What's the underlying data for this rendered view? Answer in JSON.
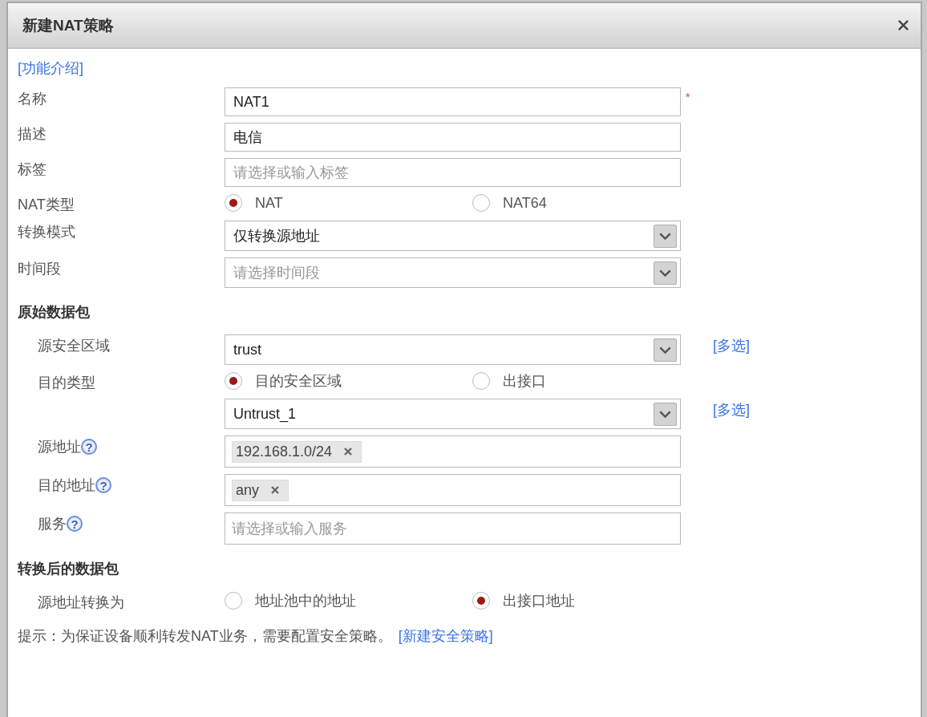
{
  "window": {
    "title": "新建NAT策略"
  },
  "intro_link": "[功能介绍]",
  "fields": [
    {
      "kind": "input",
      "label": "名称",
      "value": "NAT1",
      "required_mark": "*"
    },
    {
      "kind": "input",
      "label": "描述",
      "value": "电信"
    },
    {
      "kind": "input",
      "label": "标签",
      "placeholder": "请选择或输入标签"
    },
    {
      "kind": "radio",
      "label": "NAT类型",
      "options": [
        {
          "label": "NAT",
          "selected": true
        },
        {
          "label": "NAT64",
          "selected": false
        }
      ]
    },
    {
      "kind": "select",
      "label": "转换模式",
      "value": "仅转换源地址"
    },
    {
      "kind": "select",
      "label": "时间段",
      "placeholder": "请选择时间段"
    }
  ],
  "sections": [
    {
      "heading": "原始数据包",
      "fields": [
        {
          "kind": "select",
          "label": "源安全区域",
          "value": "trust",
          "link": "[多选]"
        },
        {
          "kind": "radio",
          "label": "目的类型",
          "options": [
            {
              "label": "目的安全区域",
              "selected": true
            },
            {
              "label": "出接口",
              "selected": false
            }
          ]
        },
        {
          "kind": "select",
          "value": "Untrust_1",
          "link": "[多选]"
        },
        {
          "kind": "tags",
          "label": "源地址",
          "help": "?",
          "tags": [
            "192.168.1.0/24"
          ]
        },
        {
          "kind": "tags",
          "label": "目的地址",
          "help": "?",
          "tags": [
            "any"
          ]
        },
        {
          "kind": "tags",
          "label": "服务",
          "help": "?",
          "placeholder": "请选择或输入服务"
        }
      ]
    },
    {
      "heading": "转换后的数据包",
      "fields": [
        {
          "kind": "radio",
          "label": "源地址转换为",
          "options": [
            {
              "label": "地址池中的地址",
              "selected": false
            },
            {
              "label": "出接口地址",
              "selected": true
            }
          ]
        }
      ]
    }
  ],
  "hint": {
    "text": "提示：为保证设备顺利转发NAT业务，需要配置安全策略。",
    "link": "[新建安全策略]"
  }
}
